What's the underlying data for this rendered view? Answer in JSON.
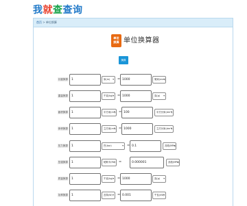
{
  "site": {
    "logo_chars": [
      "我",
      "就",
      "查",
      "查询"
    ],
    "logo_colors": [
      "#1f78c8",
      "#e8412d",
      "#18a34a",
      "#1f78c8"
    ]
  },
  "breadcrumb": {
    "home": "首页",
    "sep": ">",
    "current": "单位换算"
  },
  "app": {
    "icon_line1": "单位",
    "icon_line2": "换算",
    "title": "单位换算器"
  },
  "convert_button": "换算",
  "rows": [
    {
      "label": "长度换算",
      "value": "1",
      "unit_from": "米(m)",
      "value_to": "1000",
      "unit_to": "毫米(mm)"
    },
    {
      "label": "重量换算",
      "value": "1",
      "unit_from": "千克(kg)",
      "value_to": "1000",
      "unit_to": "克(g)"
    },
    {
      "label": "面积换算",
      "value": "1",
      "unit_from": "平方米(m²)",
      "value_to": "100",
      "unit_to": "平方分米(dm²)"
    },
    {
      "label": "体积换算",
      "value": "1",
      "unit_from": "立方米(m³)",
      "value_to": "1000",
      "unit_to": "立方分米(dm³)"
    },
    {
      "label": "压力换算",
      "value": "1",
      "unit_from": "巴(bar)",
      "value_to": "0.1",
      "unit_to": "兆帕(MPa)"
    },
    {
      "label": "压强换算",
      "value": "1",
      "unit_from": "帕斯卡(Pa)",
      "value_to": "0.000001",
      "unit_to": "兆帕(MPa)"
    },
    {
      "label": "质量换算",
      "value": "1",
      "unit_from": "千克(kg)",
      "value_to": "1000",
      "unit_to": "克(g)"
    },
    {
      "label": "功率换算",
      "value": "1",
      "unit_from": "瓦特(W)",
      "value_to": "0.001",
      "unit_to": "千瓦(kW)"
    }
  ]
}
